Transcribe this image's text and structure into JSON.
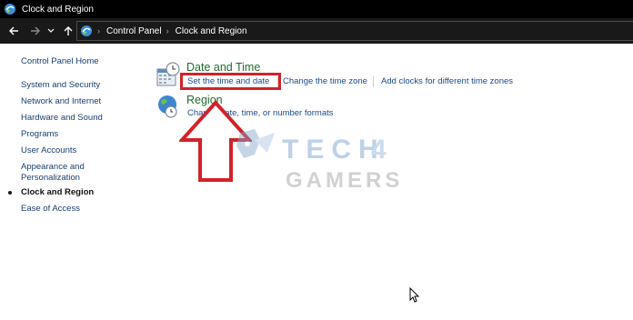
{
  "window": {
    "title": "Clock and Region"
  },
  "nav": {
    "back_icon": "back-arrow-icon",
    "forward_icon": "forward-arrow-icon",
    "up_icon": "up-arrow-icon"
  },
  "breadcrumb": {
    "items": [
      "Control Panel",
      "Clock and Region"
    ]
  },
  "sidebar": {
    "items": [
      {
        "label": "Control Panel Home"
      },
      {
        "label": "System and Security"
      },
      {
        "label": "Network and Internet"
      },
      {
        "label": "Hardware and Sound"
      },
      {
        "label": "Programs"
      },
      {
        "label": "User Accounts"
      },
      {
        "label_line1": "Appearance and",
        "label_line2": "Personalization"
      },
      {
        "label": "Clock and Region",
        "active": true
      },
      {
        "label": "Ease of Access"
      }
    ]
  },
  "main": {
    "date_time": {
      "title": "Date and Time",
      "links": [
        "Set the time and date",
        "Change the time zone",
        "Add clocks for different time zones"
      ]
    },
    "region": {
      "title": "Region",
      "links": [
        "Change date, time, or number formats"
      ]
    }
  },
  "watermark": {
    "line1": "TECH",
    "digit": "4",
    "line2": "GAMERS"
  },
  "colors": {
    "accent_red": "#d1222a",
    "category_green": "#1e6c2e",
    "link_blue": "#1a4b8c"
  }
}
